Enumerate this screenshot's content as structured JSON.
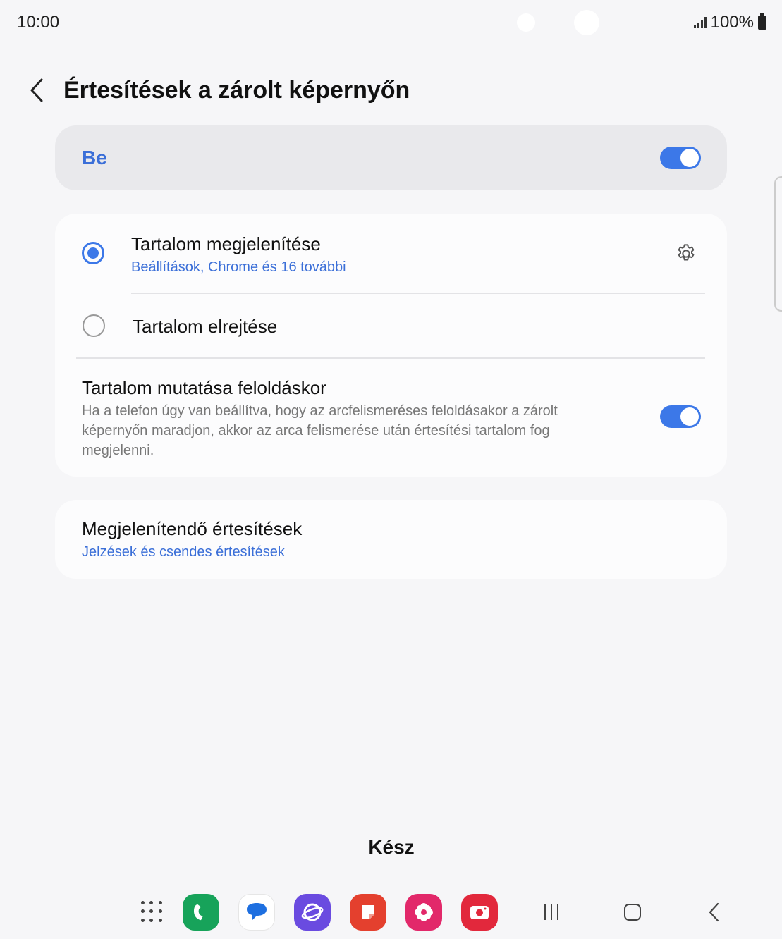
{
  "status_bar": {
    "time": "10:00",
    "battery_text": "100%",
    "signal_icon": "signal-icon",
    "battery_icon": "battery-icon"
  },
  "header": {
    "title": "Értesítések a zárolt képernyőn",
    "back_icon": "back-arrow-icon"
  },
  "master_switch": {
    "label": "Be",
    "enabled": true
  },
  "content_options": {
    "show": {
      "title": "Tartalom megjelenítése",
      "subtitle": "Beállítások, Chrome és 16 további",
      "selected": true,
      "settings_icon": "gear-icon"
    },
    "hide": {
      "title": "Tartalom elrejtése",
      "selected": false
    },
    "unlock": {
      "title": "Tartalom mutatása feloldáskor",
      "description": "Ha a telefon úgy van beállítva, hogy az arcfelismeréses feloldásakor a zárolt képernyőn maradjon, akkor az arca felismerése után értesítési tartalom fog megjelenni.",
      "enabled": true
    }
  },
  "notifications_to_show": {
    "title": "Megjelenítendő értesítések",
    "subtitle": "Jelzések és csendes értesítések"
  },
  "done_label": "Kész",
  "navbar": {
    "apps": [
      "apps-grid-icon",
      "phone-icon",
      "messages-icon",
      "internet-icon",
      "notes-icon",
      "gallery-icon",
      "camera-icon"
    ],
    "system": [
      "recents-icon",
      "home-icon",
      "back-icon"
    ]
  },
  "colors": {
    "accent": "#3c78e8",
    "background": "#f6f6f8",
    "card": "#fcfcfd"
  }
}
